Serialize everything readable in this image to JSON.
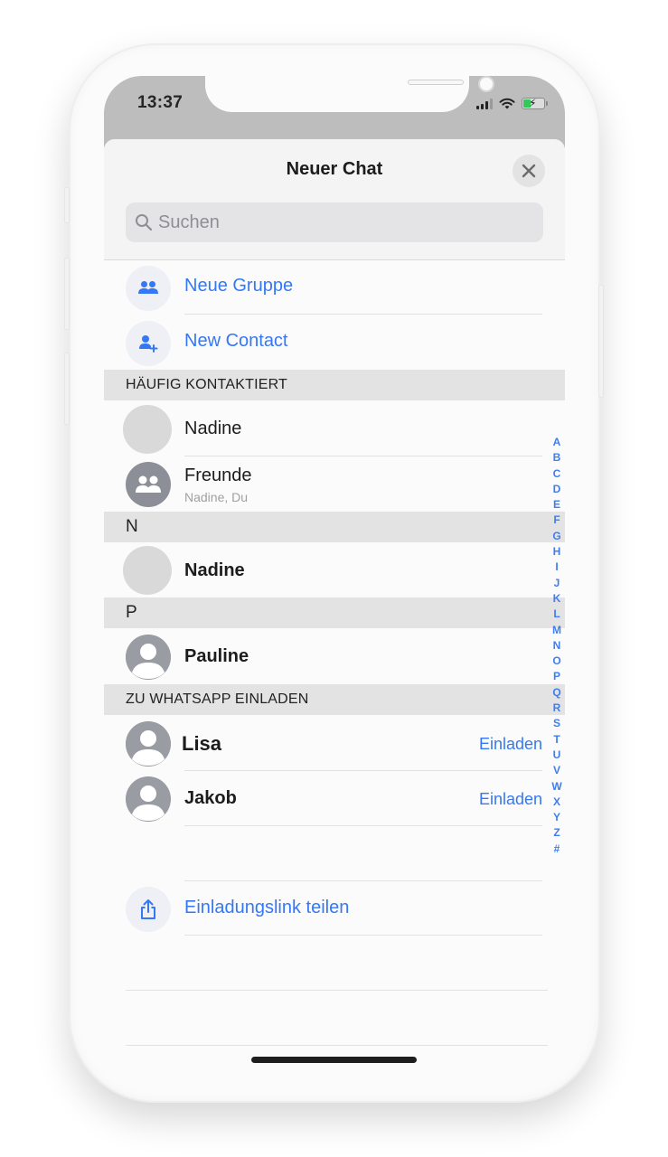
{
  "status_bar": {
    "time": "13:37",
    "signal_icon": "cellular-signal-icon",
    "wifi_icon": "wifi-icon",
    "battery_icon": "battery-charging-icon",
    "battery_fill_fraction": 0.35,
    "battery_color": "#34c759"
  },
  "header": {
    "title": "Neuer Chat",
    "close_icon": "close-icon"
  },
  "search": {
    "placeholder": "Suchen",
    "value": "",
    "icon": "search-icon"
  },
  "actions": [
    {
      "label": "Neue Gruppe",
      "icon": "group-icon"
    },
    {
      "label": "New Contact",
      "icon": "add-contact-icon"
    }
  ],
  "sections": {
    "frequent": {
      "title": "HÄUFIG KONTAKTIERT",
      "items": [
        {
          "name": "Nadine",
          "subtitle": "",
          "avatar": "blank-avatar"
        },
        {
          "name": "Freunde",
          "subtitle": "Nadine, Du",
          "avatar": "group-avatar-icon"
        }
      ]
    },
    "n": {
      "title": "N",
      "items": [
        {
          "name": "Nadine",
          "avatar": "blank-avatar"
        }
      ]
    },
    "p": {
      "title": "P",
      "items": [
        {
          "name": "Pauline",
          "avatar": "person-avatar-icon"
        }
      ]
    },
    "invite": {
      "title": "ZU WHATSAPP EINLADEN",
      "items": [
        {
          "name": "Lisa",
          "action": "Einladen",
          "avatar": "person-avatar-icon"
        },
        {
          "name": "Jakob",
          "action": "Einladen",
          "avatar": "person-avatar-icon"
        }
      ]
    }
  },
  "share_link": {
    "label": "Einladungslink teilen",
    "icon": "share-icon"
  },
  "index_letters": [
    "A",
    "B",
    "C",
    "D",
    "E",
    "F",
    "G",
    "H",
    "I",
    "J",
    "K",
    "L",
    "M",
    "N",
    "O",
    "P",
    "Q",
    "R",
    "S",
    "T",
    "U",
    "V",
    "W",
    "X",
    "Y",
    "Z",
    "#"
  ],
  "colors": {
    "accent": "#3478f6",
    "section_bg": "#e3e3e3",
    "status_bar_bg": "#bdbdbd"
  }
}
